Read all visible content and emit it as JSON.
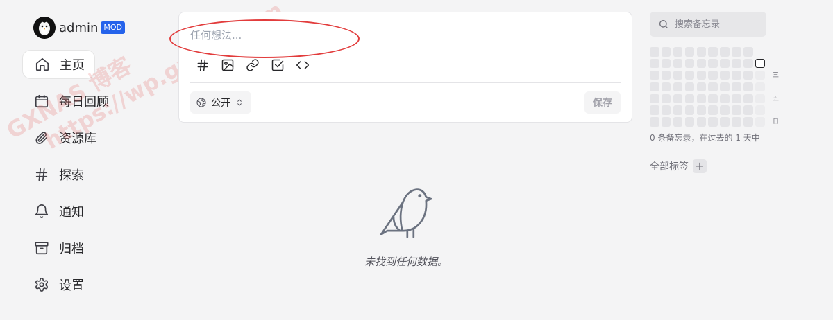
{
  "user": {
    "name": "admin",
    "badge": "MOD"
  },
  "nav": [
    {
      "id": "home",
      "label": "主页",
      "icon": "home-icon",
      "active": true
    },
    {
      "id": "daily-review",
      "label": "每日回顾",
      "icon": "calendar-icon"
    },
    {
      "id": "resources",
      "label": "资源库",
      "icon": "paperclip-icon"
    },
    {
      "id": "explore",
      "label": "探索",
      "icon": "hash-icon"
    },
    {
      "id": "notifications",
      "label": "通知",
      "icon": "bell-icon"
    },
    {
      "id": "archive",
      "label": "归档",
      "icon": "archive-icon"
    },
    {
      "id": "settings",
      "label": "设置",
      "icon": "gear-icon"
    }
  ],
  "watermark": {
    "line1": "GXNAS 博客",
    "line2": "https://wp.gxnas.com"
  },
  "editor": {
    "placeholder": "任何想法...",
    "tools": [
      "hash-icon",
      "image-icon",
      "link-icon",
      "checkbox-icon",
      "code-icon"
    ],
    "visibility": "公开",
    "save_label": "保存"
  },
  "empty_state": {
    "text": "未找到任何数据。"
  },
  "search": {
    "placeholder": "搜索备忘录"
  },
  "heatmap": {
    "weekday_labels": [
      "一",
      "三",
      "五",
      "日"
    ],
    "rows": 7,
    "cols": 10
  },
  "stats": {
    "text": "0 条备忘录，在过去的 1 天中"
  },
  "tags": {
    "label": "全部标签",
    "add": "+"
  },
  "colors": {
    "accent": "#2563eb",
    "annotation": "#e23c3c"
  }
}
